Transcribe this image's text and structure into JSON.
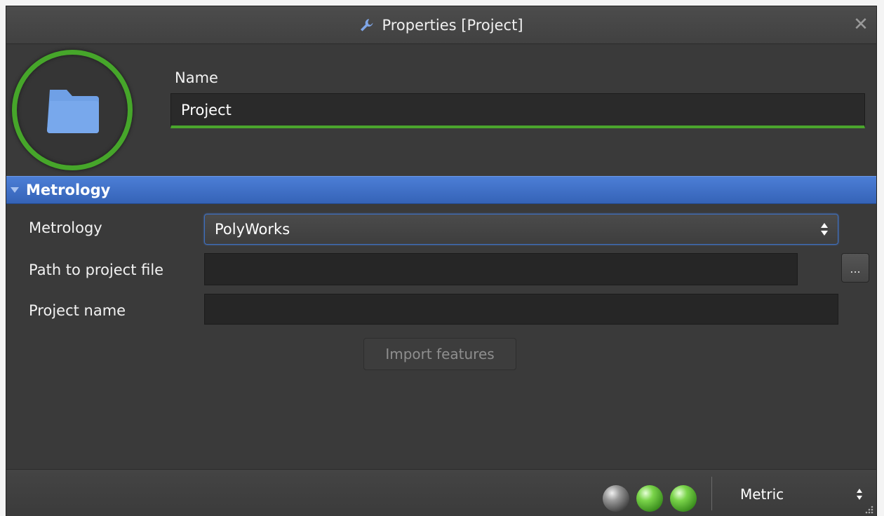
{
  "window": {
    "title": "Properties [Project]",
    "title_icon": "wrench-icon",
    "close_icon": "close-icon"
  },
  "header": {
    "avatar_icon": "folder-icon",
    "name_label": "Name",
    "name_value": "Project"
  },
  "section": {
    "title": "Metrology",
    "expanded": true,
    "rows": {
      "metrology_label": "Metrology",
      "metrology_value": "PolyWorks",
      "path_label": "Path to project file",
      "path_value": "",
      "browse_label": "...",
      "project_name_label": "Project name",
      "project_name_value": ""
    },
    "import_button": "Import features"
  },
  "statusbar": {
    "indicators": [
      "gray",
      "green",
      "green"
    ],
    "units": "Metric"
  },
  "colors": {
    "accent_green": "#46a62a",
    "section_blue": "#3f70c8",
    "window_bg": "#3a3a3a"
  }
}
